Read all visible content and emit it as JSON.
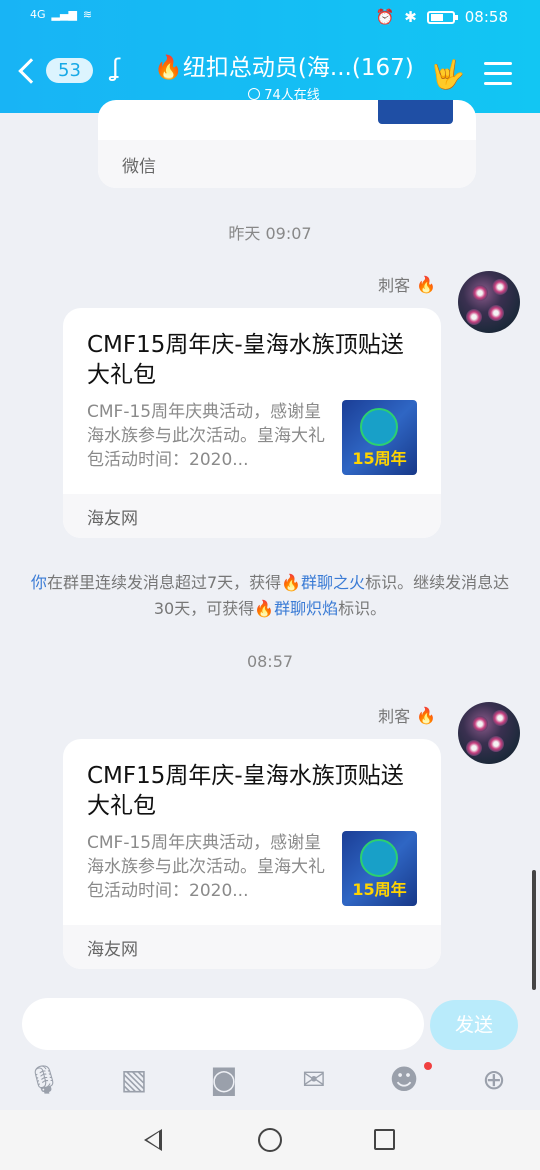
{
  "status": {
    "network": "4G",
    "time": "08:58"
  },
  "header": {
    "unread_count": "53",
    "title": "🔥纽扣总动员(海...(167)",
    "online": "74人在线"
  },
  "prev_card": {
    "source": "微信"
  },
  "messages": [
    {
      "time": "昨天 09:07",
      "sender": "刺客",
      "card_title": "CMF15周年庆-皇海水族顶贴送大礼包",
      "card_desc": "CMF-15周年庆典活动，感谢皇海水族参与此次活动。皇海大礼包活动时间：2020...",
      "thumb_text": "15周年",
      "source": "海友网"
    },
    {
      "time": "08:57",
      "sender": "刺客",
      "card_title": "CMF15周年庆-皇海水族顶贴送大礼包",
      "card_desc": "CMF-15周年庆典活动，感谢皇海水族参与此次活动。皇海大礼包活动时间：2020...",
      "thumb_text": "15周年",
      "source": "海友网"
    }
  ],
  "system": {
    "part1": "你",
    "part2": "在群里连续发消息超过7天，获得",
    "badge1": "群聊之火",
    "part3": "标识。继续发消息达30天，可获得",
    "badge2": "群聊炽焰",
    "part4": "标识。"
  },
  "input": {
    "placeholder": "",
    "send_label": "发送"
  },
  "icons": [
    "mic-icon",
    "image-icon",
    "camera-icon",
    "red-packet-icon",
    "emoji-icon",
    "plus-icon"
  ]
}
